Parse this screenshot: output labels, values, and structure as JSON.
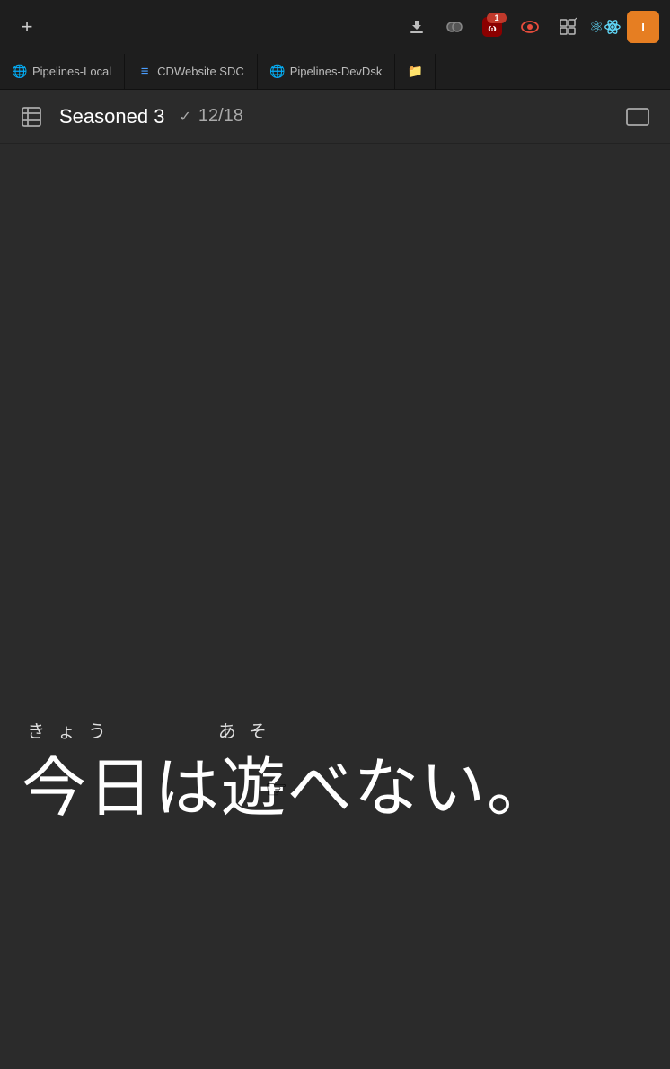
{
  "topbar": {
    "add_button_label": "+",
    "icons": [
      {
        "name": "download-icon",
        "symbol": "⬇",
        "badge": null,
        "color": "#ccc"
      },
      {
        "name": "record-icon",
        "symbol": "⏺",
        "badge": null,
        "color": "#ccc"
      },
      {
        "name": "workalike-icon",
        "symbol": "W",
        "badge": "1",
        "color": "#c0392b"
      },
      {
        "name": "eye-icon",
        "symbol": "👁",
        "badge": null,
        "color": "#e74c3c"
      },
      {
        "name": "grid-icon",
        "symbol": "⊞",
        "badge": null,
        "color": "#ccc"
      },
      {
        "name": "react-icon",
        "symbol": "⚛",
        "badge": null,
        "color": "#61dafb"
      },
      {
        "name": "identity-icon",
        "symbol": "I",
        "badge": null,
        "color": "#e67e22"
      }
    ]
  },
  "tabs": [
    {
      "name": "pipelines-local-tab",
      "label": "Pipelines-Local",
      "icon": "globe"
    },
    {
      "name": "cdwebsite-sdc-tab",
      "label": "CDWebsite SDC",
      "icon": "list"
    },
    {
      "name": "pipelines-devdsk-tab",
      "label": "Pipelines-DevDsk",
      "icon": "globe"
    },
    {
      "name": "folder-tab",
      "label": "",
      "icon": "folder"
    }
  ],
  "content_header": {
    "deck_icon": "⊠",
    "title": "Seasoned 3",
    "check_icon": "✓",
    "progress": "12/18",
    "presentation_icon": "▭"
  },
  "japanese": {
    "furigana": "きょう        あそ",
    "main_text": "今日は遊べない。",
    "furigana_parts": [
      {
        "furi": "きょう",
        "kanji": "今日"
      },
      {
        "furi": "あそ",
        "kanji": "遊"
      }
    ]
  }
}
